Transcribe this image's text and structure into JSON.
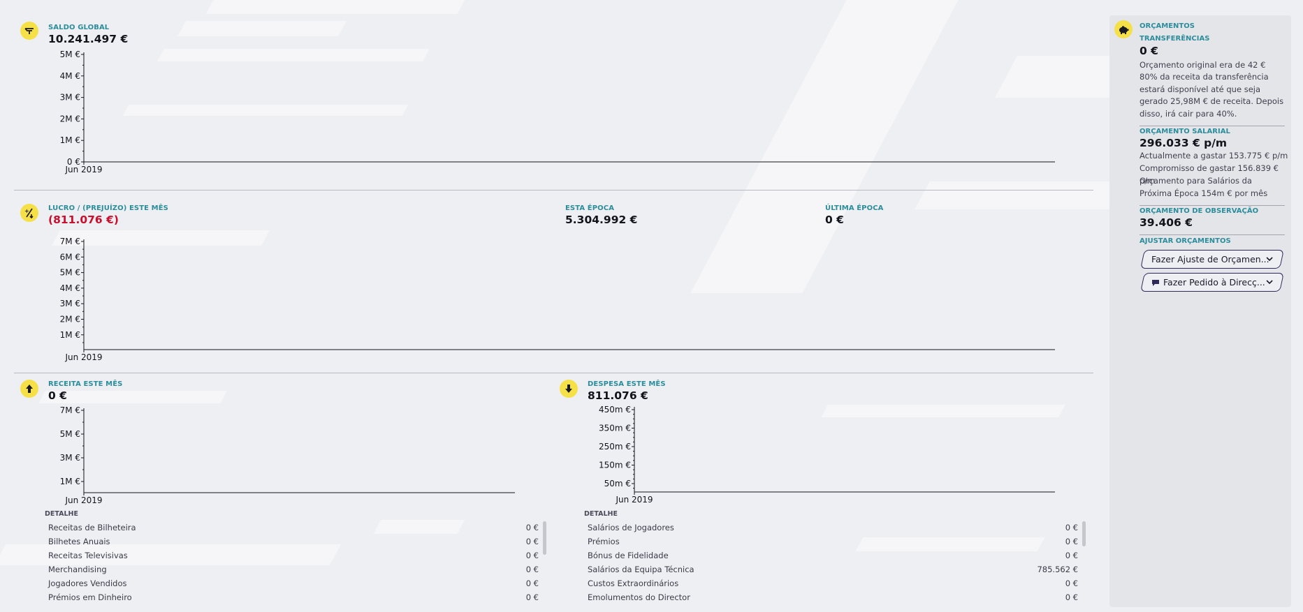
{
  "saldo": {
    "label": "SALDO GLOBAL",
    "value": "10.241.497 €",
    "chart": {
      "ticks": [
        "5M €",
        "4M €",
        "3M €",
        "2M €",
        "1M €",
        "0 €"
      ],
      "xtick": "Jun 2019"
    }
  },
  "lucro": {
    "label": "LUCRO / (PREJUÍZO) ESTE MÊS",
    "value": "(811.076 €)",
    "esta_epoca_label": "ESTA ÉPOCA",
    "esta_epoca_value": "5.304.992 €",
    "ultima_epoca_label": "ÚLTIMA ÉPOCA",
    "ultima_epoca_value": "0 €",
    "chart": {
      "ticks": [
        "7M €",
        "6M €",
        "5M €",
        "4M €",
        "3M €",
        "2M €",
        "1M €"
      ],
      "xtick": "Jun 2019"
    }
  },
  "receita": {
    "label": "RECEITA ESTE MÊS",
    "value": "0 €",
    "chart": {
      "ticks": [
        "7M €",
        "5M €",
        "3M €",
        "1M €"
      ],
      "xtick": "Jun 2019"
    },
    "detail_header": "DETALHE",
    "rows": [
      {
        "name": "Receitas de Bilheteira",
        "value": "0 €"
      },
      {
        "name": "Bilhetes Anuais",
        "value": "0 €"
      },
      {
        "name": "Receitas Televisivas",
        "value": "0 €"
      },
      {
        "name": "Merchandising",
        "value": "0 €"
      },
      {
        "name": "Jogadores Vendidos",
        "value": "0 €"
      },
      {
        "name": "Prémios em Dinheiro",
        "value": "0 €"
      }
    ]
  },
  "despesa": {
    "label": "DESPESA ESTE MÊS",
    "value": "811.076 €",
    "chart": {
      "ticks": [
        "450m €",
        "350m €",
        "250m €",
        "150m €",
        "50m €"
      ],
      "xtick": "Jun 2019"
    },
    "detail_header": "DETALHE",
    "rows": [
      {
        "name": "Salários de Jogadores",
        "value": "0 €"
      },
      {
        "name": "Prémios",
        "value": "0 €"
      },
      {
        "name": "Bónus de Fidelidade",
        "value": "0 €"
      },
      {
        "name": "Salários da Equipa Técnica",
        "value": "785.562 €"
      },
      {
        "name": "Custos Extraordinários",
        "value": "0 €"
      },
      {
        "name": "Emolumentos do Director",
        "value": "0 €"
      }
    ]
  },
  "sidebar": {
    "title": "ORÇAMENTOS",
    "transfer_label": "TRANSFERÊNCIAS",
    "transfer_value": "0 €",
    "transfer_line1": "Orçamento original era de 42 €",
    "transfer_line2": "80% da receita da transferência estará disponível até que seja gerado 25,98M € de receita. Depois disso, irá cair para 40%.",
    "salary_label": "ORÇAMENTO SALARIAL",
    "salary_value": "296.033 € p/m",
    "salary_line1": "Actualmente a gastar 153.775 € p/m",
    "salary_line2": "Compromisso de gastar 156.839 € p/m",
    "salary_line3": "Orçamento para Salários da Próxima Época 154m € por mês",
    "scouting_label": "ORÇAMENTO DE OBSERVAÇÃO",
    "scouting_value": "39.406 €",
    "adjust_label": "AJUSTAR ORÇAMENTOS",
    "adjust_button": "Fazer Ajuste de Orçamen...",
    "request_button": "Fazer Pedido à Direcç..."
  },
  "colors": {
    "accent_label": "#2b8d9c",
    "icon_bg": "#f6e047",
    "negative": "#c8102e"
  }
}
